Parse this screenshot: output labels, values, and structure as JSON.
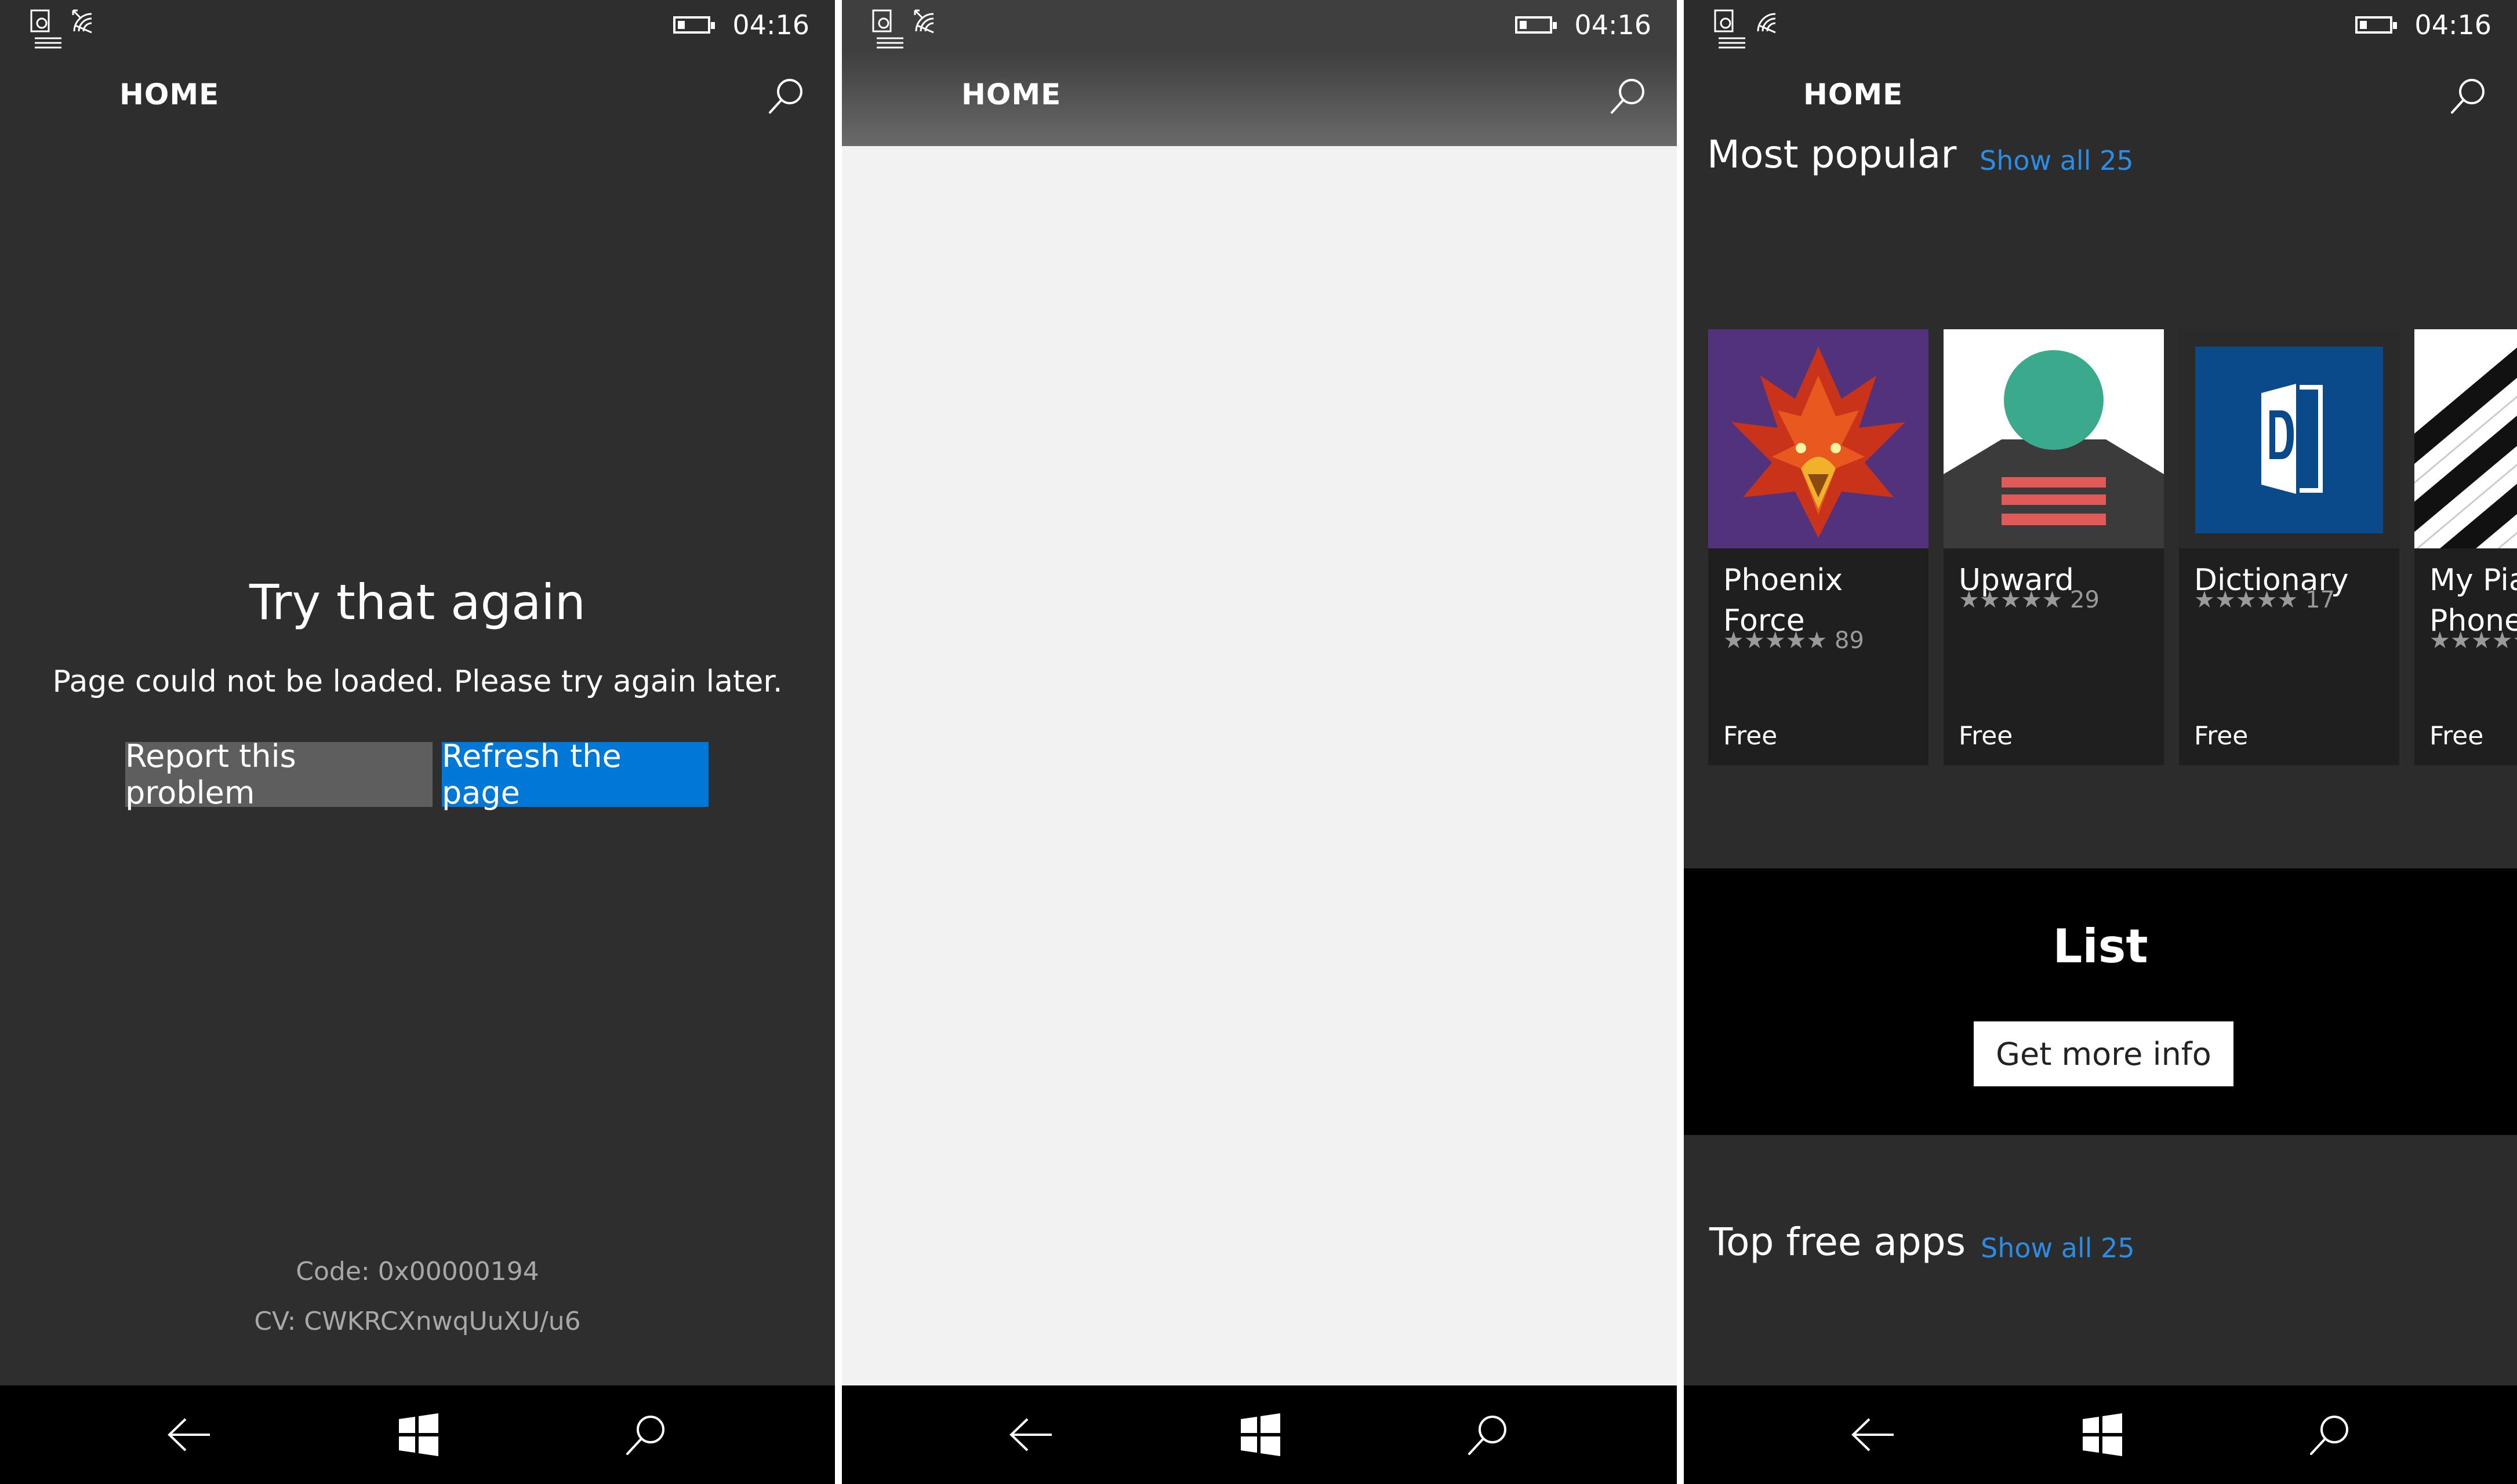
{
  "status": {
    "time": "04:16"
  },
  "header": {
    "title": "HOME"
  },
  "error_screen": {
    "title": "Try that again",
    "message": "Page could not be loaded. Please try again later.",
    "report_label": "Report this problem",
    "refresh_label": "Refresh the page",
    "code": "Code: 0x00000194",
    "cv": "CV: CWKRCXnwqUuXU/u6"
  },
  "store": {
    "most_popular": {
      "title": "Most popular",
      "show_all": "Show all 25",
      "apps": [
        {
          "name": "Phoenix\nForce",
          "stars": "★★★★★",
          "rating_count": "89",
          "price": "Free",
          "icon": "phoenix-bird-icon"
        },
        {
          "name": "Upward",
          "stars": "★★★★★",
          "rating_count": "29",
          "price": "Free",
          "icon": "upward-circle-icon"
        },
        {
          "name": "Dictionary",
          "stars": "★★★★★",
          "rating_count": "17",
          "price": "Free",
          "icon": "dictionary-book-icon"
        },
        {
          "name": "My Piano\nPhone",
          "stars": "★★★★★",
          "rating_count": "",
          "price": "Free",
          "icon": "piano-keys-icon"
        }
      ]
    },
    "banner": {
      "title": "List",
      "button": "Get more info"
    },
    "top_free": {
      "title": "Top free apps",
      "show_all": "Show all 25"
    }
  },
  "colors": {
    "accent": "#0078d7",
    "link": "#2a8ee8",
    "dark_bg": "#2e2e2e",
    "light_bg": "#f2f2f2"
  }
}
